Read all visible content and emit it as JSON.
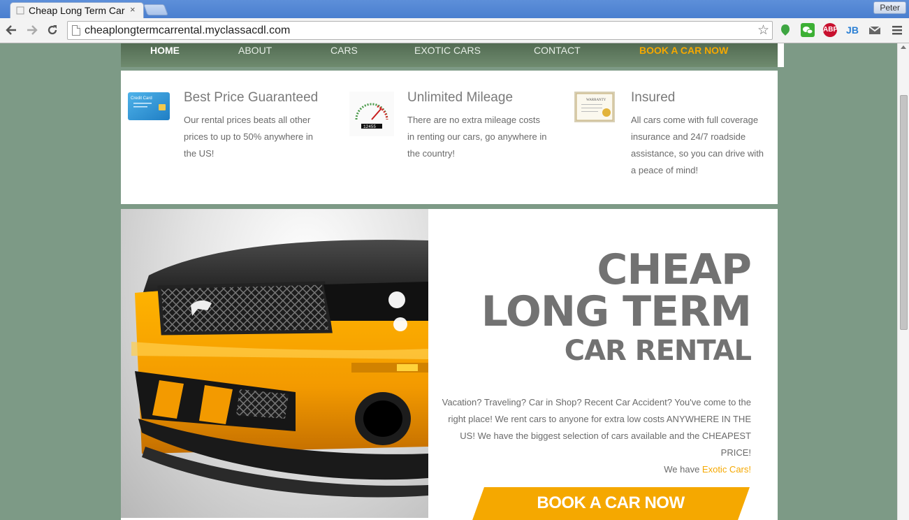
{
  "browser": {
    "tab_title": "Cheap Long Term Car Rental",
    "tab_close": "×",
    "profile_name": "Peter",
    "url": "cheaplongtermcarrental.myclassacdl.com",
    "extensions": [
      "evernote-icon",
      "wechat-icon",
      "adblock-plus-icon",
      "jetbrains-icon",
      "gmail-icon",
      "menu-icon"
    ],
    "extension_labels": {
      "abp": "ABP",
      "jb": "JB"
    }
  },
  "site": {
    "nav": {
      "items": [
        "HOME",
        "ABOUT",
        "CARS",
        "EXOTIC CARS",
        "CONTACT",
        "BOOK A CAR NOW"
      ],
      "active": "HOME"
    },
    "features": [
      {
        "icon": "credit-card-icon",
        "icon_text": "Credit Card",
        "title": "Best Price Guaranteed",
        "text": "Our rental prices beats all other prices to up to 50% anywhere in the US!"
      },
      {
        "icon": "speedometer-icon",
        "icon_text": "12455",
        "title": "Unlimited Mileage",
        "text": "There are no extra mileage costs in renting our cars, go anywhere in the country!"
      },
      {
        "icon": "warranty-certificate-icon",
        "icon_text": "WARRANTY",
        "title": "Insured",
        "text": "All cars come with full coverage insurance and 24/7 roadside assistance, so you can drive with a peace of mind!"
      }
    ],
    "hero": {
      "title_line1": "CHEAP",
      "title_line2": "LONG TERM",
      "title_line3": "CAR RENTAL",
      "body": "Vacation? Traveling? Car in Shop? Recent Car Accident? You've come to the right place! We rent cars to anyone for extra low costs ANYWHERE IN THE US! We have the biggest selection of cars available and the CHEAPEST PRICE!",
      "exotic_prefix": "We have ",
      "exotic_link": "Exotic Cars!",
      "button": "BOOK A CAR NOW",
      "image": "yellow-mustang-car-image"
    },
    "colors": {
      "accent": "#f5a800",
      "nav_bg": "#5d775d",
      "page_bg": "#7d9a86",
      "heading": "#727272"
    }
  }
}
